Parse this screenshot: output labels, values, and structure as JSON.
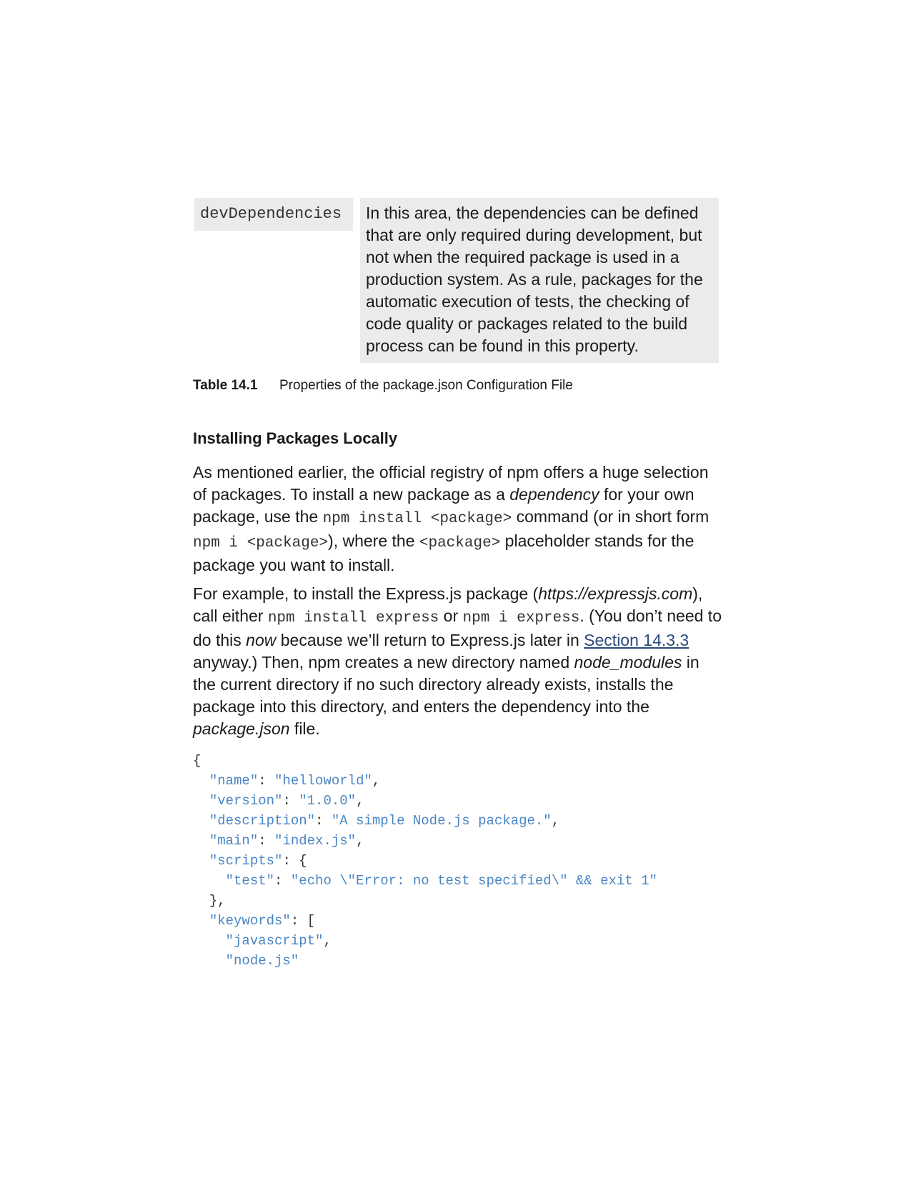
{
  "table_row": {
    "property": "devDependencies",
    "description": "In this area, the dependencies can be defined that are only required during development, but not when the required package is used in a production system. As a rule, packages for the automatic execution of tests, the checking of code quality or packages related to the build process can be found in this property."
  },
  "caption": {
    "number": "Table 14.1",
    "text": "Properties of the package.json Configuration File"
  },
  "heading": "Installing Packages Locally",
  "paragraph1": {
    "t1": "As mentioned earlier, the official registry of npm offers a huge selection of packages. To install a new package as a ",
    "em1": "dependency",
    "t2": " for your own package, use the ",
    "code1": "npm install <package>",
    "t3": " command (or in short form ",
    "code2": "npm i <package>",
    "t4": "), where the ",
    "code3": "<package>",
    "t5": " placeholder stands for the package you want to install."
  },
  "paragraph2": {
    "t1": "For example, to install the Express.js package (",
    "em1": "https://expressjs.com",
    "t2": "), call either ",
    "code1": "npm install express",
    "t3": " or ",
    "code2": "npm i express",
    "t4": ". (You don’t need to do this ",
    "em2": "now",
    "t5": " because we’ll return to Express.js later in ",
    "link": "Section 14.3.3",
    "t6": " anyway.) Then, npm creates a new directory named ",
    "em3": "node_modules",
    "t7": " in the current directory if no such directory already exists, installs the package into this directory, and enters the dependency into the ",
    "em4": "package.json",
    "t8": " file."
  },
  "code_block": {
    "lines": [
      "{",
      "  \"name\": \"helloworld\",",
      "  \"version\": \"1.0.0\",",
      "  \"description\": \"A simple Node.js package.\",",
      "  \"main\": \"index.js\",",
      "  \"scripts\": {",
      "    \"test\": \"echo \\\"Error: no test specified\\\" && exit 1\"",
      "  },",
      "  \"keywords\": [",
      "    \"javascript\",",
      "    \"node.js\""
    ]
  },
  "colors": {
    "table_bg": "#ebebeb",
    "code_string": "#4a86c4",
    "link": "#2b4a7a"
  }
}
